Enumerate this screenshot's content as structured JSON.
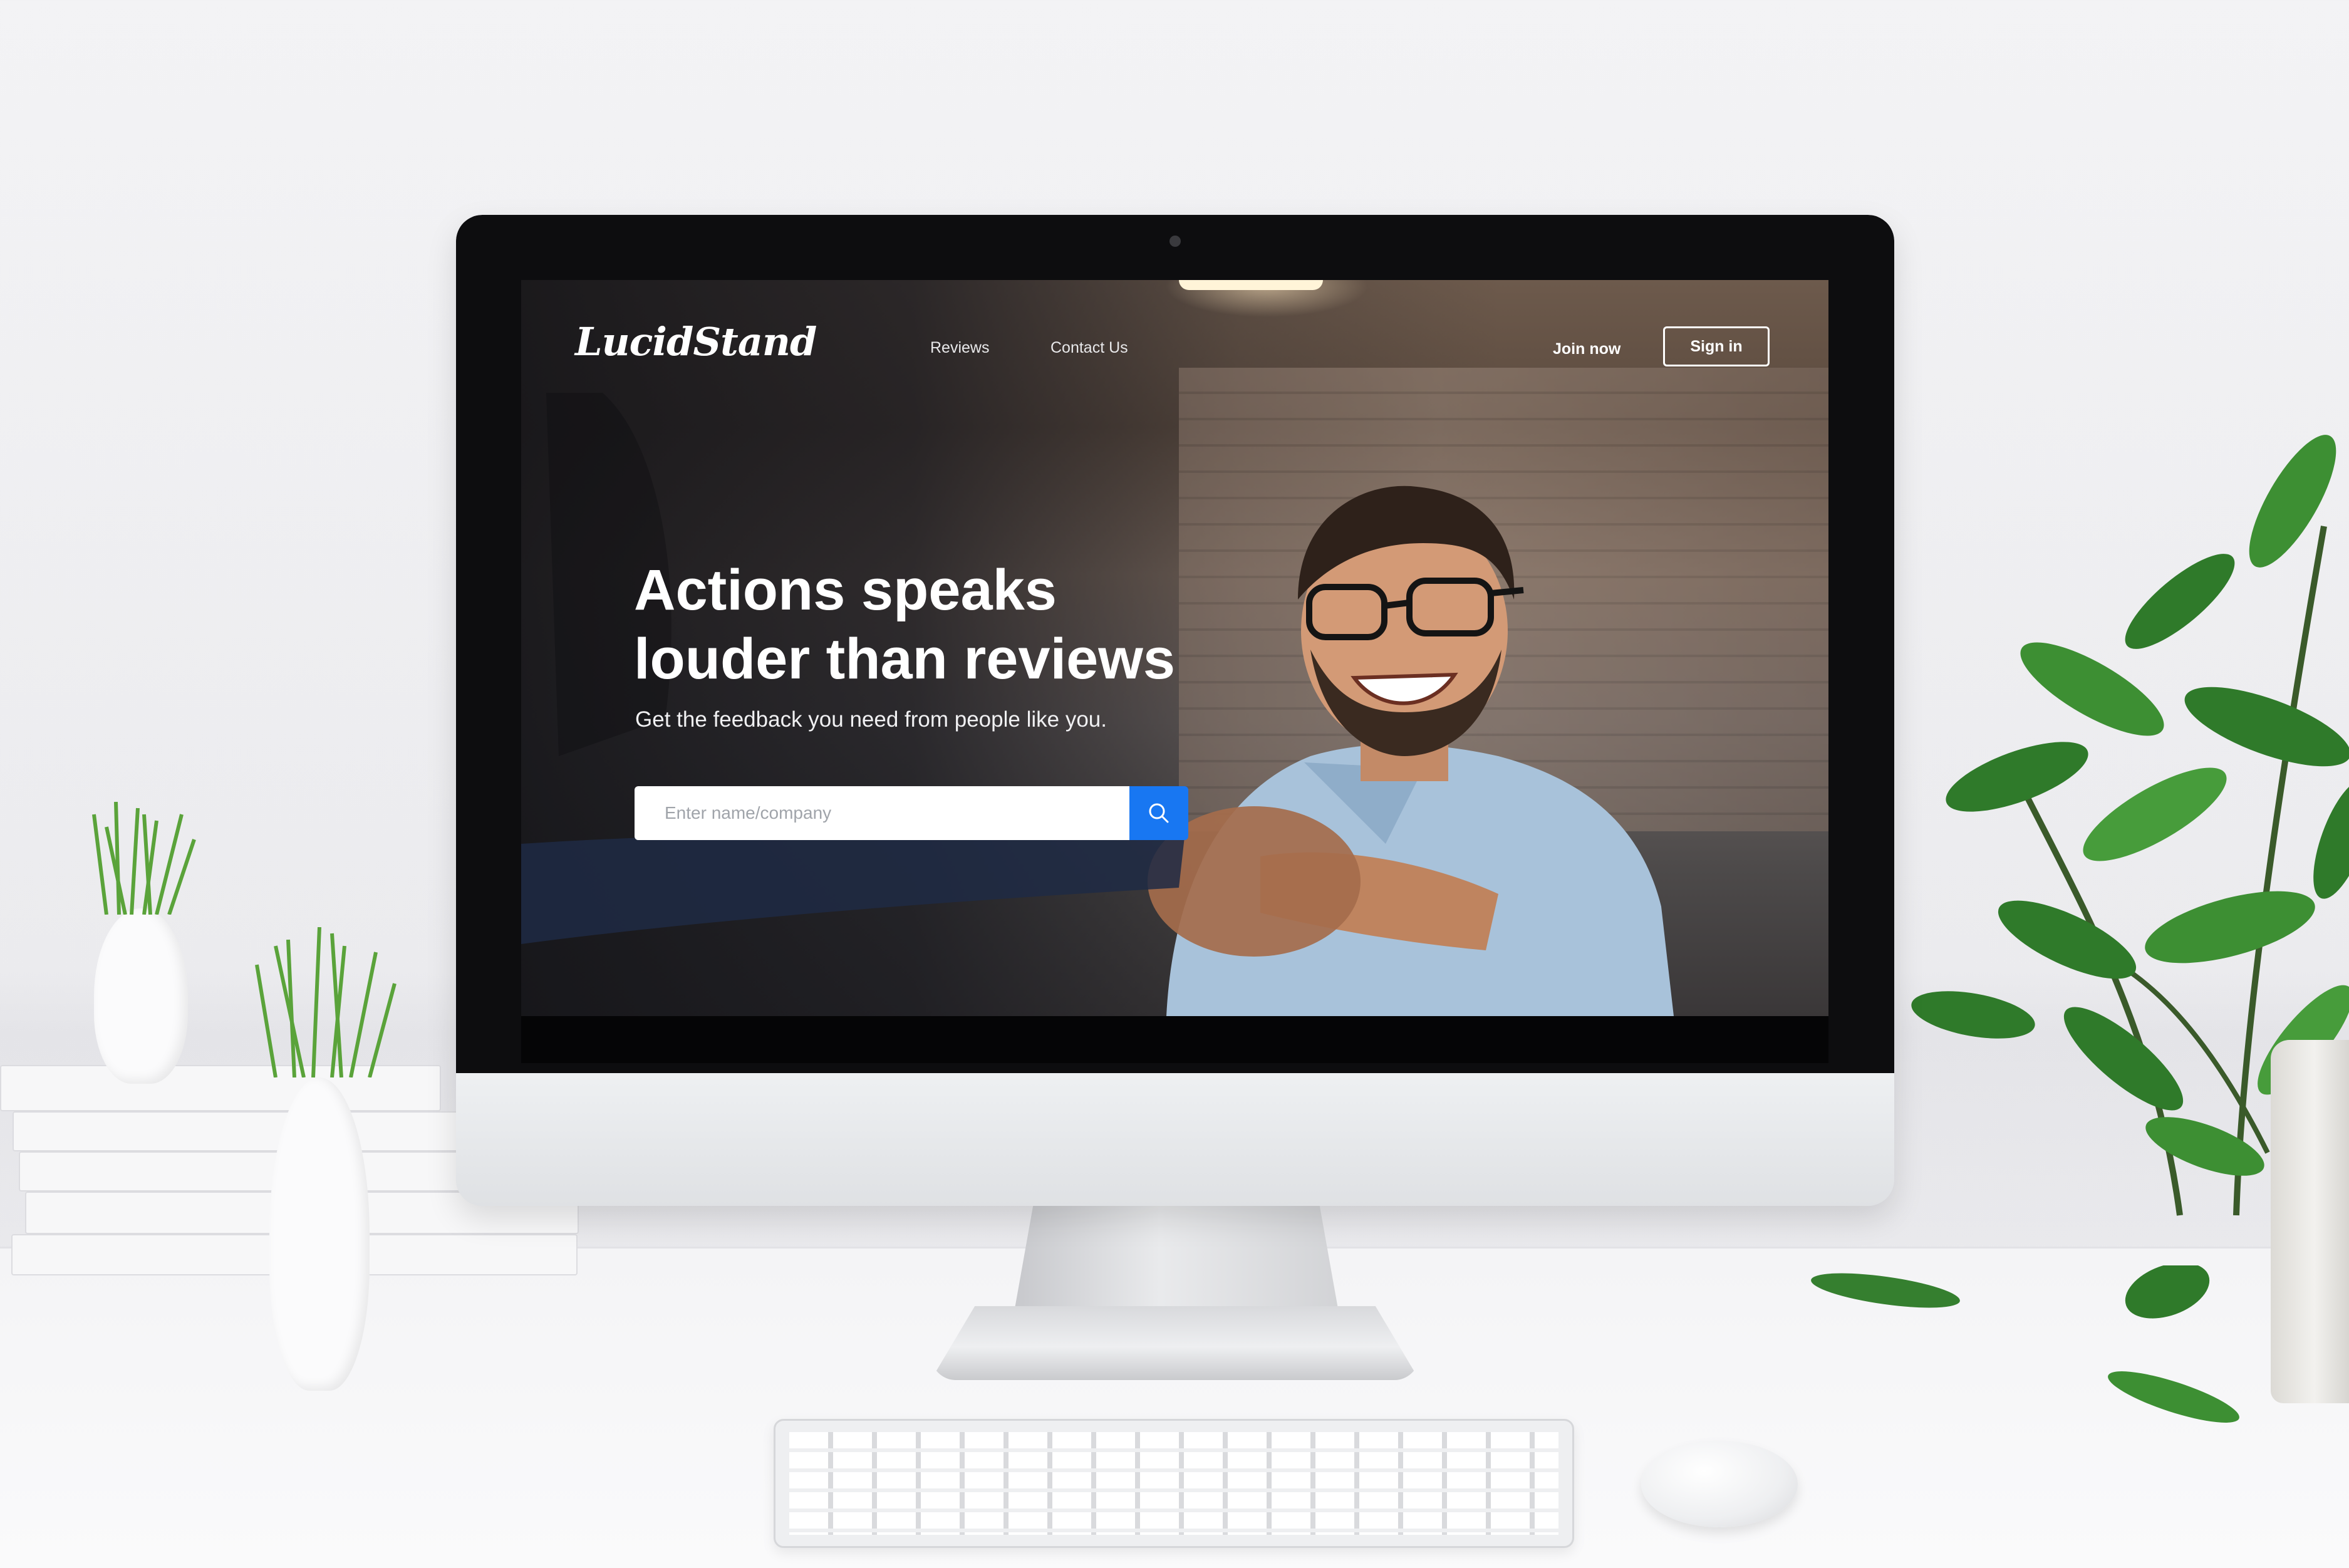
{
  "site": {
    "logo_text": "LucidStand",
    "nav": {
      "reviews_label": "Reviews",
      "contact_label": "Contact Us",
      "join_label": "Join now",
      "signin_label": "Sign in"
    },
    "hero": {
      "headline_line1": "Actions speaks",
      "headline_line2": "louder than reviews",
      "subline": "Get the feedback you need from people like you."
    },
    "search": {
      "placeholder": "Enter name/company",
      "button_icon": "search-icon"
    }
  },
  "colors": {
    "accent": "#1877f2",
    "text_on_dark": "#ffffff"
  }
}
